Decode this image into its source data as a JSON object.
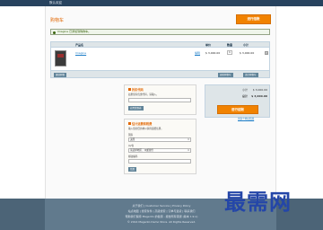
{
  "topbar": {
    "link": "默认欢迎"
  },
  "page": {
    "title": "购物车",
    "checkout_top": "进行结账"
  },
  "success": {
    "text": "Imagine 已添加到购物车。"
  },
  "table": {
    "headers": [
      "产品名",
      "单价",
      "数量",
      "小计"
    ],
    "row": {
      "product": "Imagine",
      "edit": "编辑",
      "price": "$ 3,000.00",
      "qty": "1",
      "subtotal": "$ 3,000.00",
      "remove": "×"
    },
    "footer_left": "继续购物",
    "footer_update": "更新购物车",
    "footer_clear": "清空购物车"
  },
  "discount": {
    "title": "折扣代码",
    "label": "如果您有优惠代码，请输入。",
    "input": "",
    "button": "应用优惠券"
  },
  "shipping": {
    "title": "估计运费和税费",
    "label": "输入您的目的地以获得运费估算。",
    "country_label": "国家",
    "country_value": "美国",
    "region_label": "州/省",
    "region_value": "请选择地区、州或省份",
    "zip_label": "邮政编码",
    "zip_value": "",
    "button": "估算"
  },
  "totals": {
    "subtotal_label": "小计",
    "subtotal_value": "$ 3,000.00",
    "grand_label": "总计",
    "grand_value": "$ 3,000.00",
    "checkout": "进行结账",
    "multi": "用多个地址结账"
  },
  "footer": {
    "line1": "关于我们 | Customer Service | Privacy Policy",
    "line2": "站点地图 | 搜索条件 | 高级搜索 | 订单与退货 | 联系我们",
    "line3": "帮助我们保持 Magento 的健康 - 报告所有错误 (版本 1.9.x)",
    "line4": "© 2014 Magento Demo Store. All Rights Reserved."
  },
  "watermark": "最需网"
}
